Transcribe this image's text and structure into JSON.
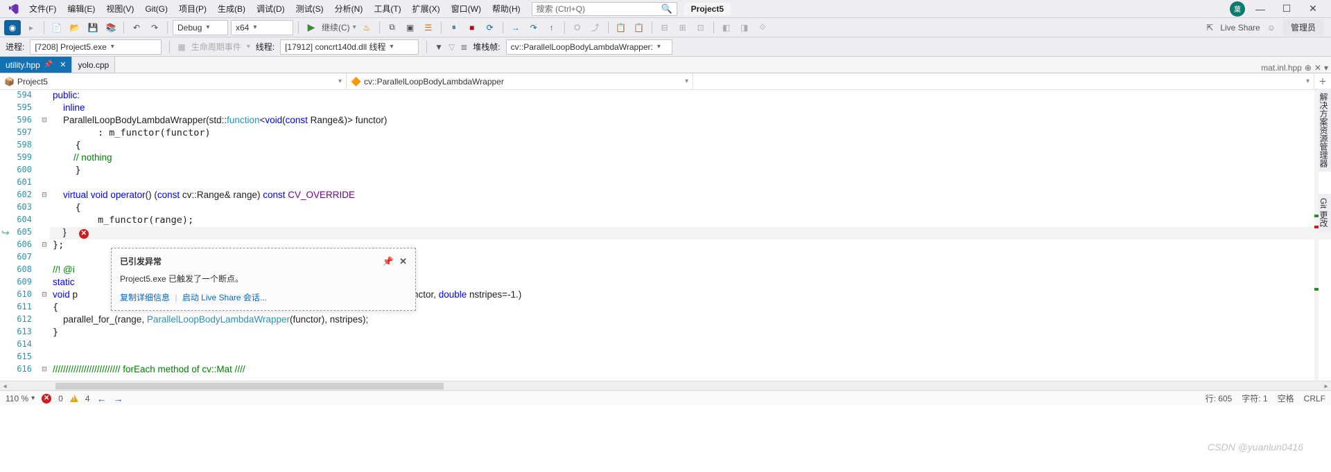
{
  "menu": {
    "items": [
      "文件(F)",
      "编辑(E)",
      "视图(V)",
      "Git(G)",
      "项目(P)",
      "生成(B)",
      "调试(D)",
      "测试(S)",
      "分析(N)",
      "工具(T)",
      "扩展(X)",
      "窗口(W)",
      "帮助(H)"
    ]
  },
  "search": {
    "placeholder": "搜索 (Ctrl+Q)"
  },
  "project": "Project5",
  "toolbar": {
    "config": "Debug",
    "platform": "x64",
    "continue": "继续(C)",
    "liveshare": "Live Share",
    "admin": "管理员"
  },
  "debugbar": {
    "procLabel": "进程:",
    "proc": "[7208] Project5.exe",
    "lifecycle": "生命周期事件",
    "threadLabel": "线程:",
    "thread": "[17912] concrt140d.dll 线程",
    "stackLabel": "堆栈帧:",
    "stack": "cv::ParallelLoopBodyLambdaWrapper:"
  },
  "tabs": {
    "active": "utility.hpp",
    "other": "yolo.cpp",
    "right": "mat.inl.hpp"
  },
  "nav": {
    "scope1": "Project5",
    "scope2": "cv::ParallelLoopBodyLambdaWrapper",
    "scope3": ""
  },
  "rightPanels": {
    "solution": "解决方案资源管理器",
    "git": "Git 更改"
  },
  "code": {
    "594": "public:",
    "595": "    inline",
    "596a": "    ",
    "596b": "ParallelLoopBodyLambdaWrapper",
    "596c": "(std::",
    "596d": "function",
    "596e": "<",
    "596f": "void",
    "596g": "(",
    "596h": "const",
    "596i": " Range&)> functor)",
    "597": "        : m_functor(functor)",
    "598": "    {",
    "599": "        // nothing",
    "600": "    }",
    "601": "",
    "602a": "    ",
    "602b": "virtual",
    "602c": " void ",
    "602d": "operator",
    "602e": "() (",
    "602f": "const",
    "602g": " cv::Range& range) ",
    "602h": "const",
    "602i": " ",
    "602j": "CV_OVERRIDE",
    "603": "    {",
    "604": "        m_functor(range);",
    "605": "    }",
    "606": "};",
    "607": "",
    "608": "//! @i",
    "609": "static",
    "610a": "void",
    "610b": " p",
    "610c": "e&)> functor, ",
    "610d": "double",
    "610e": " nstripes=-1.)",
    "611": "{",
    "612a": "    parallel_for_(range, ",
    "612b": "ParallelLoopBodyLambdaWrapper",
    "612c": "(functor), nstripes);",
    "613": "}",
    "614": "",
    "615": "",
    "616a": "////////////////////////// ",
    "616b": "forEach method of cv::Mat",
    "616c": " ////"
  },
  "popup": {
    "title": "已引发异常",
    "message": "Project5.exe 已触发了一个断点。",
    "link1": "复制详细信息",
    "link2": "启动 Live Share 会话..."
  },
  "status": {
    "zoom": "110 %",
    "errors": "0",
    "warnings": "4",
    "line": "行: 605",
    "col": "字符: 1",
    "spaces": "空格",
    "crlf": "CRLF"
  },
  "watermark": "CSDN @yuanlun0416"
}
